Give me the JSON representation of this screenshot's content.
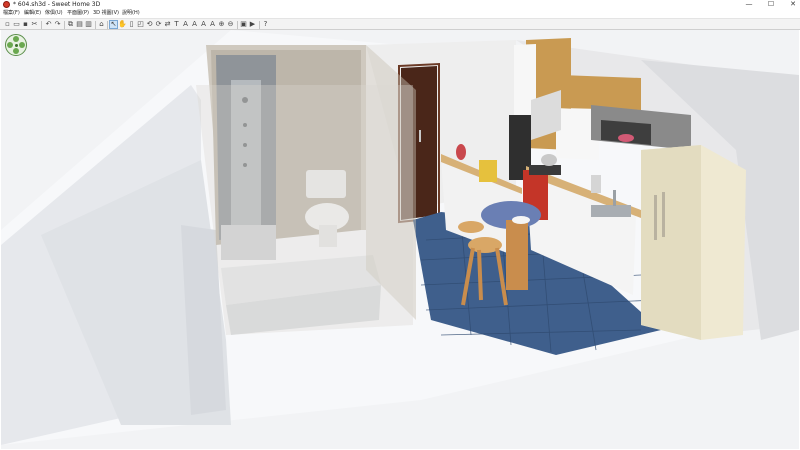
{
  "window": {
    "title": "* 604.sh3d - Sweet Home 3D"
  },
  "window_controls": {
    "minimize": "—",
    "maximize": "☐",
    "close": "✕"
  },
  "menu": {
    "items": [
      {
        "label": "檔案(F)"
      },
      {
        "label": "編輯(E)"
      },
      {
        "label": "傢俱(U)"
      },
      {
        "label": "平面圖(P)"
      },
      {
        "label": "3D 視圖(V)"
      },
      {
        "label": "說明(H)"
      }
    ]
  },
  "toolbar": {
    "icons": [
      "new-file-icon",
      "open-file-icon",
      "save-icon",
      "cut-icon",
      "copy-icon",
      "paste-icon",
      "undo-icon",
      "redo-icon",
      "delete-icon",
      "add-furniture-icon",
      "import-furniture-icon",
      "select-mode-icon",
      "pan-icon",
      "create-walls-icon",
      "create-rooms-icon",
      "create-polylines-icon",
      "create-dimensions-icon",
      "add-text-icon",
      "zoom-in-icon",
      "zoom-out-icon",
      "rotate-icon",
      "create-photo-icon",
      "create-video-icon",
      "help-icon"
    ],
    "selected_tool": "select-mode-icon"
  },
  "viewport": {
    "background": "#f2f3f5",
    "floor_color": "#3f5f8c",
    "wall_color": "#e9eaec",
    "door_color": "#4a2619"
  }
}
